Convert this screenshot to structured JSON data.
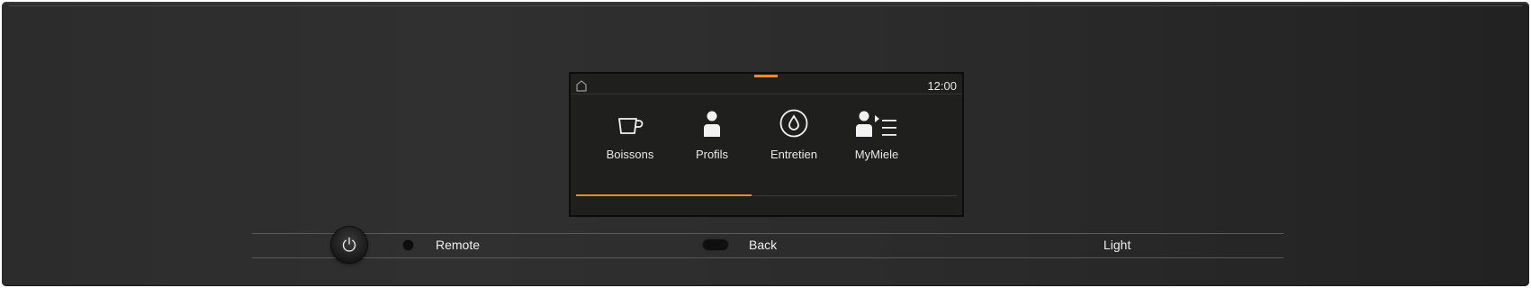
{
  "display": {
    "clock": "12:00",
    "menu": [
      {
        "label": "Boissons",
        "icon": "coffee-cup-icon"
      },
      {
        "label": "Profils",
        "icon": "person-icon"
      },
      {
        "label": "Entretien",
        "icon": "water-drop-icon"
      },
      {
        "label": "MyMiele",
        "icon": "user-menu-icon"
      }
    ],
    "page_progress": 0.46
  },
  "controls": {
    "remote_label": "Remote",
    "back_label": "Back",
    "light_label": "Light"
  },
  "colors": {
    "accent": "#f08a24",
    "panel": "#2c2c2c",
    "screen": "#1f201e",
    "text": "#e8e8e8"
  }
}
